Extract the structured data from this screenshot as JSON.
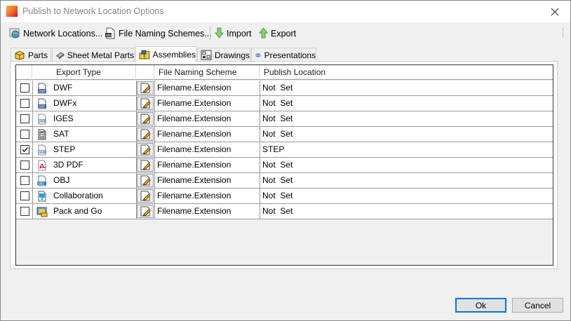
{
  "window": {
    "title": "Publish to Network Location Options"
  },
  "toolbar": {
    "network_locations": "Network Locations...",
    "file_naming_schemes": "File Naming Schemes...",
    "import": "Import",
    "export": "Export"
  },
  "tabs": [
    {
      "label": "Parts"
    },
    {
      "label": "Sheet Metal Parts"
    },
    {
      "label": "Assemblies"
    },
    {
      "label": "Drawings"
    },
    {
      "label": "Presentations"
    }
  ],
  "active_tab": "Assemblies",
  "grid": {
    "columns": {
      "export_type": "Export Type",
      "naming": "File Naming Scheme",
      "location": "Publish Location"
    },
    "rows": [
      {
        "checked": false,
        "type": "DWF",
        "icon": "dwf-file-icon",
        "naming": "Filename.Extension",
        "location": "Not  Set"
      },
      {
        "checked": false,
        "type": "DWFx",
        "icon": "dwfx-file-icon",
        "naming": "Filename.Extension",
        "location": "Not  Set"
      },
      {
        "checked": false,
        "type": "IGES",
        "icon": "iges-file-icon",
        "naming": "Filename.Extension",
        "location": "Not  Set"
      },
      {
        "checked": false,
        "type": "SAT",
        "icon": "sat-file-icon",
        "naming": "Filename.Extension",
        "location": "Not  Set"
      },
      {
        "checked": true,
        "type": "STEP",
        "icon": "step-file-icon",
        "naming": "Filename.Extension",
        "location": "STEP"
      },
      {
        "checked": false,
        "type": "3D PDF",
        "icon": "pdf-file-icon",
        "naming": "Filename.Extension",
        "location": "Not  Set"
      },
      {
        "checked": false,
        "type": "OBJ",
        "icon": "obj-file-icon",
        "naming": "Filename.Extension",
        "location": "Not  Set"
      },
      {
        "checked": false,
        "type": "Collaboration",
        "icon": "collaboration-icon",
        "naming": "Filename.Extension",
        "location": "Not  Set"
      },
      {
        "checked": false,
        "type": "Pack and Go",
        "icon": "pack-and-go-icon",
        "naming": "Filename.Extension",
        "location": "Not  Set"
      }
    ]
  },
  "buttons": {
    "ok": "Ok",
    "cancel": "Cancel"
  },
  "colors": {
    "accent": "#0078d7",
    "pdf_red": "#d0021b",
    "import_green": "#3aa335"
  }
}
